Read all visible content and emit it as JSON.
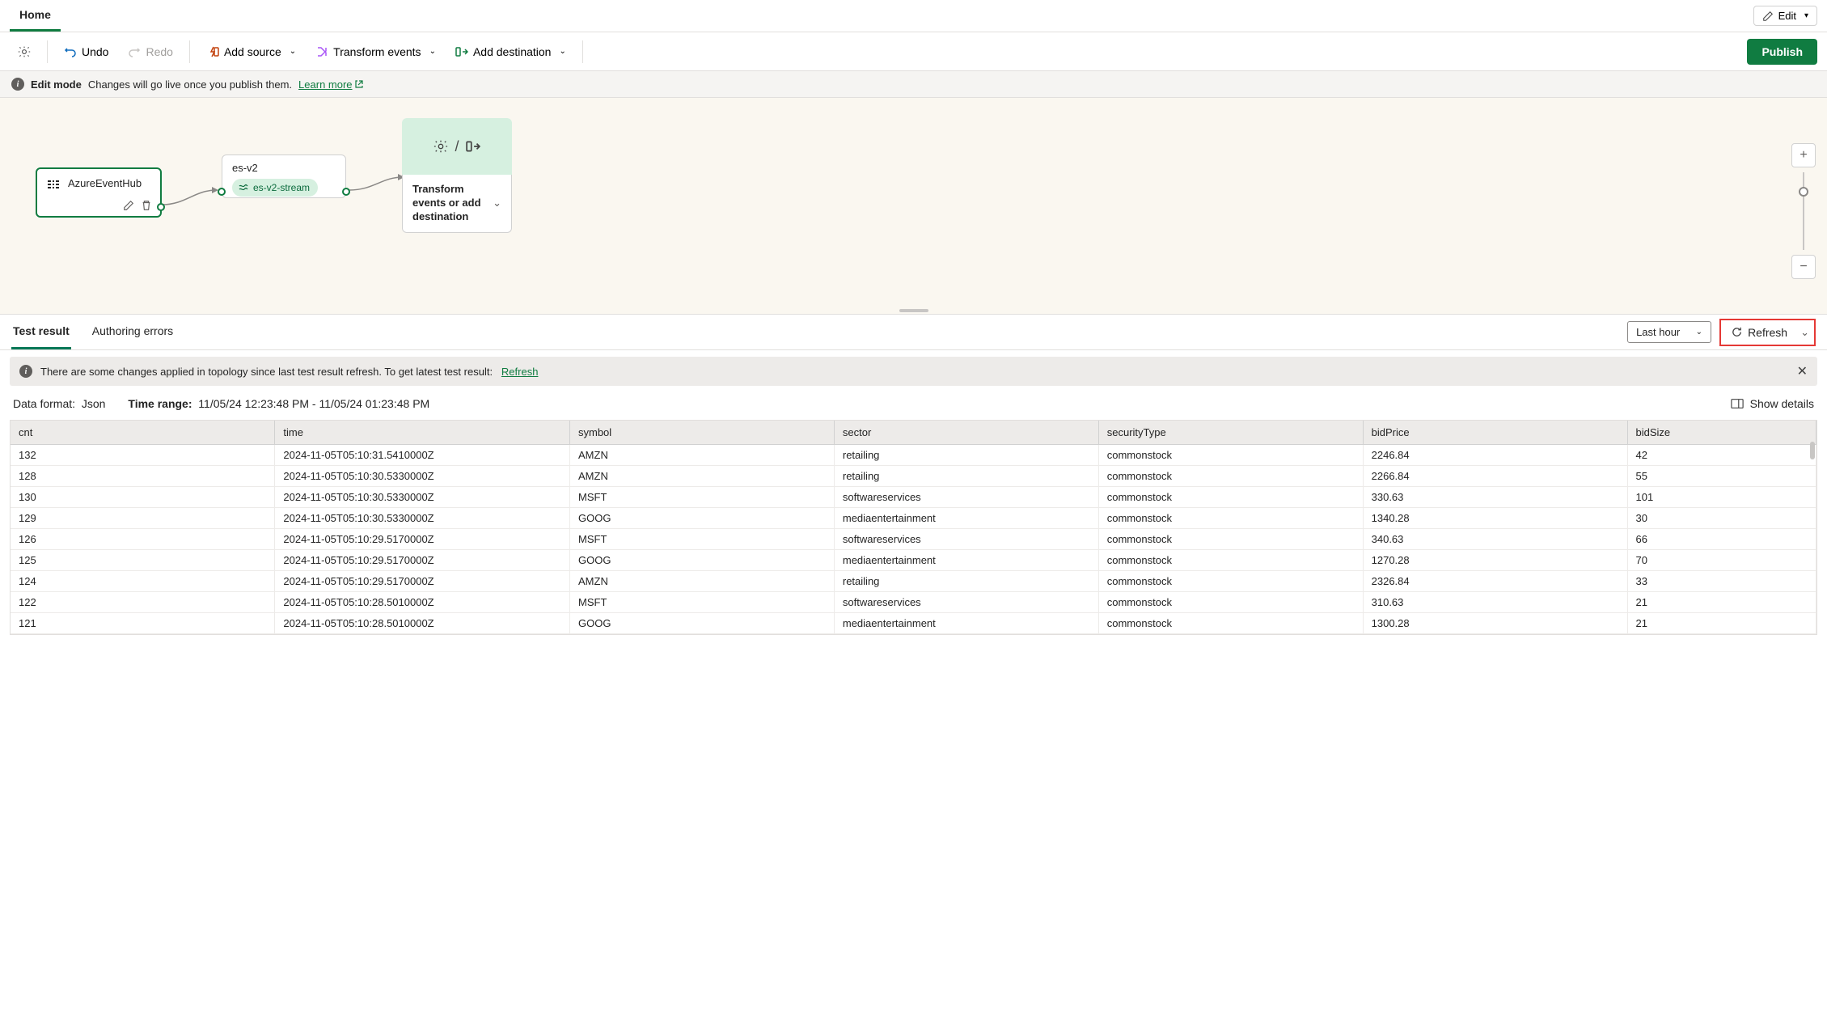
{
  "header": {
    "tab_home": "Home",
    "edit_label": "Edit"
  },
  "toolbar": {
    "undo": "Undo",
    "redo": "Redo",
    "add_source": "Add source",
    "transform": "Transform events",
    "add_dest": "Add destination",
    "publish": "Publish"
  },
  "infobar": {
    "mode": "Edit mode",
    "msg": "Changes will go live once you publish them.",
    "link": "Learn more"
  },
  "canvas": {
    "source_name": "AzureEventHub",
    "stream_name": "es-v2",
    "stream_pill": "es-v2-stream",
    "dest_text": "Transform events or add destination"
  },
  "bottom": {
    "tab_test": "Test result",
    "tab_errors": "Authoring errors",
    "time_select": "Last hour",
    "refresh": "Refresh",
    "warn_msg": "There are some changes applied in topology since last test result refresh. To get latest test result:",
    "warn_link": "Refresh",
    "data_format_label": "Data format:",
    "data_format_val": "Json",
    "time_range_label": "Time range:",
    "time_range_val": "11/05/24 12:23:48 PM - 11/05/24 01:23:48 PM",
    "show_details": "Show details"
  },
  "table": {
    "headers": {
      "cnt": "cnt",
      "time": "time",
      "symbol": "symbol",
      "sector": "sector",
      "securityType": "securityType",
      "bidPrice": "bidPrice",
      "bidSize": "bidSize"
    },
    "rows": [
      {
        "cnt": "132",
        "time": "2024-11-05T05:10:31.5410000Z",
        "symbol": "AMZN",
        "sector": "retailing",
        "securityType": "commonstock",
        "bidPrice": "2246.84",
        "bidSize": "42"
      },
      {
        "cnt": "128",
        "time": "2024-11-05T05:10:30.5330000Z",
        "symbol": "AMZN",
        "sector": "retailing",
        "securityType": "commonstock",
        "bidPrice": "2266.84",
        "bidSize": "55"
      },
      {
        "cnt": "130",
        "time": "2024-11-05T05:10:30.5330000Z",
        "symbol": "MSFT",
        "sector": "softwareservices",
        "securityType": "commonstock",
        "bidPrice": "330.63",
        "bidSize": "101"
      },
      {
        "cnt": "129",
        "time": "2024-11-05T05:10:30.5330000Z",
        "symbol": "GOOG",
        "sector": "mediaentertainment",
        "securityType": "commonstock",
        "bidPrice": "1340.28",
        "bidSize": "30"
      },
      {
        "cnt": "126",
        "time": "2024-11-05T05:10:29.5170000Z",
        "symbol": "MSFT",
        "sector": "softwareservices",
        "securityType": "commonstock",
        "bidPrice": "340.63",
        "bidSize": "66"
      },
      {
        "cnt": "125",
        "time": "2024-11-05T05:10:29.5170000Z",
        "symbol": "GOOG",
        "sector": "mediaentertainment",
        "securityType": "commonstock",
        "bidPrice": "1270.28",
        "bidSize": "70"
      },
      {
        "cnt": "124",
        "time": "2024-11-05T05:10:29.5170000Z",
        "symbol": "AMZN",
        "sector": "retailing",
        "securityType": "commonstock",
        "bidPrice": "2326.84",
        "bidSize": "33"
      },
      {
        "cnt": "122",
        "time": "2024-11-05T05:10:28.5010000Z",
        "symbol": "MSFT",
        "sector": "softwareservices",
        "securityType": "commonstock",
        "bidPrice": "310.63",
        "bidSize": "21"
      },
      {
        "cnt": "121",
        "time": "2024-11-05T05:10:28.5010000Z",
        "symbol": "GOOG",
        "sector": "mediaentertainment",
        "securityType": "commonstock",
        "bidPrice": "1300.28",
        "bidSize": "21"
      }
    ]
  }
}
